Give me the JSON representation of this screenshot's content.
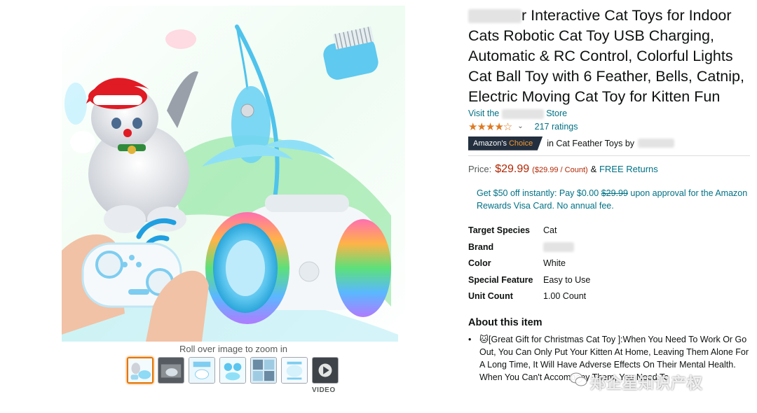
{
  "product": {
    "title": "r Interactive Cat Toys for Indoor Cats Robotic Cat Toy USB Charging, Automatic & RC Control, Colorful Lights Cat Ball Toy with 6 Feather, Bells, Catnip, Electric Moving Cat Toy for Kitten Fun",
    "store_prefix": "Visit the",
    "store_suffix": "Store",
    "stars_display": "★★★★☆",
    "rating_value": 4.3,
    "ratings_count": "217 ratings",
    "badge_text": "Amazon's",
    "badge_choice": "Choice",
    "choice_category": "in Cat Feather Toys by"
  },
  "price": {
    "label": "Price:",
    "amount": "$29.99",
    "unit": "($29.99 / Count)",
    "amp": "&",
    "free_returns": "FREE Returns"
  },
  "promo": {
    "text_before": "Get $50 off instantly: Pay $0.00",
    "strike": "$29.99",
    "text_after": "upon approval for the Amazon Rewards Visa Card. No annual fee."
  },
  "specs": [
    {
      "key": "Target Species",
      "value": "Cat"
    },
    {
      "key": "Brand",
      "value": ""
    },
    {
      "key": "Color",
      "value": "White"
    },
    {
      "key": "Special Feature",
      "value": "Easy to Use"
    },
    {
      "key": "Unit Count",
      "value": "1.00 Count"
    }
  ],
  "about": {
    "title": "About this item",
    "bullet1": "🐱[Great Gift for Christmas Cat Toy ]:When You Need To Work Or Go Out, You Can Only Put Your Kitten At Home, Leaving Them Alone For A Long Time, It Will Have Adverse Effects On Their Mental Health. When You Can't Accompany Them, You Need To"
  },
  "gallery": {
    "zoom_hint": "Roll over image to zoom in",
    "video_label": "VIDEO",
    "thumb_count": 7
  },
  "watermark": "郑企星知识产权",
  "colors": {
    "link": "#007185",
    "price": "#b12704",
    "star": "#de7921",
    "badge_bg": "#232f3e",
    "badge_choice": "#f69931",
    "active_thumb": "#e77600"
  }
}
